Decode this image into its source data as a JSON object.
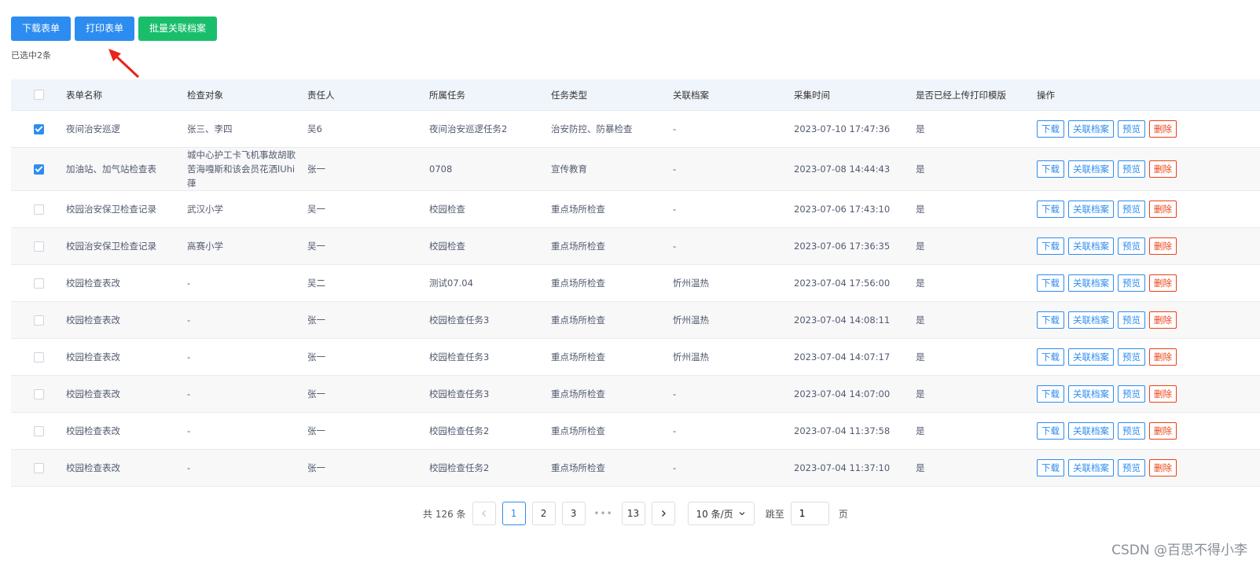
{
  "toolbar": {
    "download_label": "下载表单",
    "print_label": "打印表单",
    "batch_link_label": "批量关联档案"
  },
  "selection": {
    "text": "已选中2条"
  },
  "table": {
    "headers": [
      "表单名称",
      "检查对象",
      "责任人",
      "所属任务",
      "任务类型",
      "关联档案",
      "采集时间",
      "是否已经上传打印模版",
      "操作"
    ],
    "op_labels": {
      "download": "下载",
      "link": "关联档案",
      "preview": "预览",
      "delete": "删除"
    },
    "rows": [
      {
        "checked": true,
        "name": "夜间治安巡逻",
        "target": "张三、李四",
        "owner": "吴6",
        "task": "夜间治安巡逻任务2",
        "type": "治安防控、防暴检查",
        "archive": "-",
        "time": "2023-07-10 17:47:36",
        "uploaded": "是"
      },
      {
        "checked": true,
        "name": "加油站、加气站检查表",
        "target": "城中心护工卡飞机事故胡歌苦海嘎斯和该会员花洒lUhi葎",
        "owner": "张一",
        "task": "0708",
        "type": "宣传教育",
        "archive": "-",
        "time": "2023-07-08 14:44:43",
        "uploaded": "是"
      },
      {
        "checked": false,
        "name": "校园治安保卫检查记录",
        "target": "武汉小学",
        "owner": "吴一",
        "task": "校园检查",
        "type": "重点场所检查",
        "archive": "-",
        "time": "2023-07-06 17:43:10",
        "uploaded": "是"
      },
      {
        "checked": false,
        "name": "校园治安保卫检查记录",
        "target": "高赛小学",
        "owner": "吴一",
        "task": "校园检查",
        "type": "重点场所检查",
        "archive": "-",
        "time": "2023-07-06 17:36:35",
        "uploaded": "是"
      },
      {
        "checked": false,
        "name": "校园检查表改",
        "target": "-",
        "owner": "吴二",
        "task": "测试07.04",
        "type": "重点场所检查",
        "archive": "忻州温热",
        "time": "2023-07-04 17:56:00",
        "uploaded": "是"
      },
      {
        "checked": false,
        "name": "校园检查表改",
        "target": "-",
        "owner": "张一",
        "task": "校园检查任务3",
        "type": "重点场所检查",
        "archive": "忻州温热",
        "time": "2023-07-04 14:08:11",
        "uploaded": "是"
      },
      {
        "checked": false,
        "name": "校园检查表改",
        "target": "-",
        "owner": "张一",
        "task": "校园检查任务3",
        "type": "重点场所检查",
        "archive": "忻州温热",
        "time": "2023-07-04 14:07:17",
        "uploaded": "是"
      },
      {
        "checked": false,
        "name": "校园检查表改",
        "target": "-",
        "owner": "张一",
        "task": "校园检查任务3",
        "type": "重点场所检查",
        "archive": "-",
        "time": "2023-07-04 14:07:00",
        "uploaded": "是"
      },
      {
        "checked": false,
        "name": "校园检查表改",
        "target": "-",
        "owner": "张一",
        "task": "校园检查任务2",
        "type": "重点场所检查",
        "archive": "-",
        "time": "2023-07-04 11:37:58",
        "uploaded": "是"
      },
      {
        "checked": false,
        "name": "校园检查表改",
        "target": "-",
        "owner": "张一",
        "task": "校园检查任务2",
        "type": "重点场所检查",
        "archive": "-",
        "time": "2023-07-04 11:37:10",
        "uploaded": "是"
      }
    ]
  },
  "pagination": {
    "total_text": "共 126 条",
    "pages": [
      "1",
      "2",
      "3",
      "13"
    ],
    "current": "1",
    "ellipsis": "•••",
    "page_size": "10 条/页",
    "jump_label": "跳至",
    "jump_value": "1",
    "jump_suffix": "页"
  },
  "watermark": "CSDN @百思不得小李",
  "colors": {
    "primary": "#2d8cf0",
    "success": "#19be6b",
    "danger": "#ed4014",
    "header_bg": "#f0f4fb",
    "arrow": "#e8231c"
  }
}
